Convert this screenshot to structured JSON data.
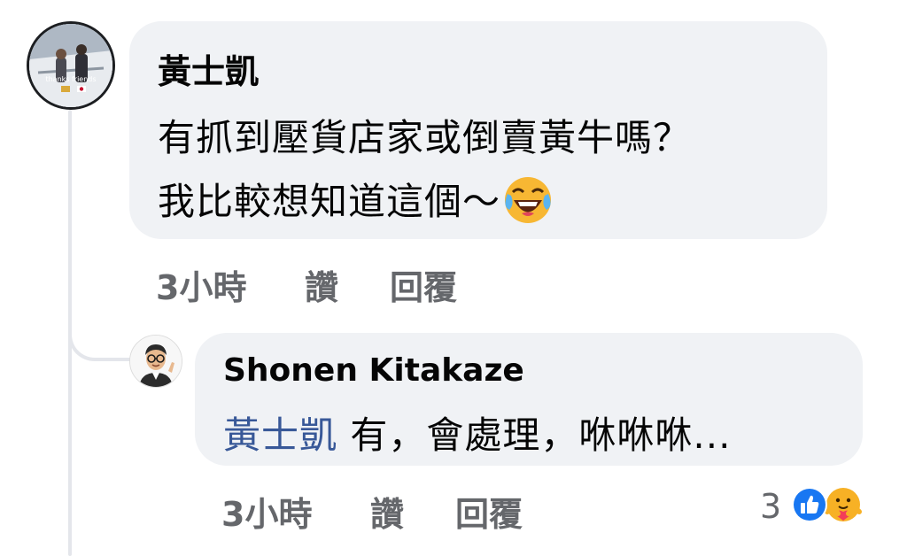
{
  "main_comment": {
    "author": "黃士凱",
    "lines": [
      "有抓到壓貨店家或倒賣黃牛嗎？",
      "我比較想知道這個～"
    ],
    "emoji": "laughing-tears-emoji",
    "avatar_caption": "thanks friends",
    "timestamp": "3小時",
    "like_label": "讚",
    "reply_label": "回覆"
  },
  "reply_comment": {
    "author": "Shonen Kitakaze",
    "mention": "黃士凱",
    "text": " 有，會處理，咻咻咻...",
    "timestamp": "3小時",
    "like_label": "讚",
    "reply_label": "回覆",
    "reaction_count": "3",
    "reaction_icons": [
      "like-reaction-icon",
      "care-reaction-icon"
    ]
  },
  "colors": {
    "bubble": "#f0f2f5",
    "action_text": "#65676b",
    "mention": "#385898",
    "like_blue": "#1877f2"
  }
}
